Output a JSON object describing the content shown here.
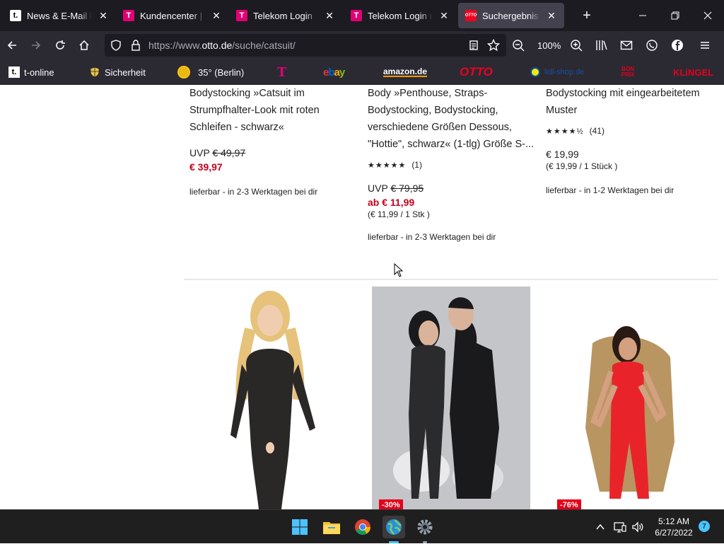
{
  "tabs": [
    {
      "title": "News & E-Mail bei t-online",
      "favicon": "t",
      "active": false
    },
    {
      "title": "Kundencenter | Telekom",
      "favicon": "telekom",
      "active": false
    },
    {
      "title": "Telekom Login",
      "favicon": "telekom",
      "active": false
    },
    {
      "title": "Telekom Login und Registrierung",
      "favicon": "telekom",
      "active": false
    },
    {
      "title": "Suchergebnis für catsuit",
      "favicon": "otto",
      "active": true
    }
  ],
  "navbar": {
    "url_prefix": "https://www.",
    "url_domain": "otto.de",
    "url_path": "/suche/catsuit/",
    "zoom": "100%"
  },
  "bookmarks": [
    {
      "label": "t-online",
      "icon": "t-online-icon"
    },
    {
      "label": "Sicherheit",
      "icon": "shield-icon"
    },
    {
      "label": "35° (Berlin)",
      "icon": "sun-icon"
    },
    {
      "label": "T",
      "icon": "telekom-logo"
    },
    {
      "label": "ebay",
      "icon": "ebay-logo"
    },
    {
      "label": "amazon.de",
      "icon": "amazon-logo"
    },
    {
      "label": "OTTO",
      "icon": "otto-logo"
    },
    {
      "label": "lidl-shop.de",
      "icon": "lidl-logo"
    },
    {
      "label": "BON PRIX",
      "icon": "bonprix-logo"
    },
    {
      "label": "KLiNGEL",
      "icon": "klingel-logo"
    }
  ],
  "products_top": [
    {
      "title": "Bodystocking »Catsuit im Strumpfhalter-Look mit roten Schleifen - schwarz«",
      "uvp_label": "UVP",
      "uvp": "€ 49,97",
      "price": "€ 39,97",
      "delivery": "lieferbar - in 2-3 Werktagen bei dir"
    },
    {
      "title": "Body »Penthouse, Straps-Bodystocking, Bodystocking, verschiedene Größen Dessous, \"Hottie\", schwarz« (1-tlg) Größe S-...",
      "rating_stars": "★★★★★",
      "rating_count": "(1)",
      "uvp_label": "UVP",
      "uvp": "€ 79,95",
      "price": "ab € 11,99",
      "unit": "(€ 11,99 / 1 Stk )",
      "delivery": "lieferbar - in 2-3 Werktagen bei dir"
    },
    {
      "title": "Bodystocking mit eingearbeitetem Muster",
      "rating_stars": "★★★★½",
      "rating_count": "(41)",
      "price": "€ 19,99",
      "unit": "(€ 19,99 / 1 Stück )",
      "delivery": "lieferbar - in 1-2 Werktagen bei dir"
    }
  ],
  "products_bottom": [
    {
      "badge": ""
    },
    {
      "badge": "-30%"
    },
    {
      "badge": "-76%"
    }
  ],
  "taskbar": {
    "time": "5:12 AM",
    "date": "6/27/2022",
    "notifications": "7"
  }
}
